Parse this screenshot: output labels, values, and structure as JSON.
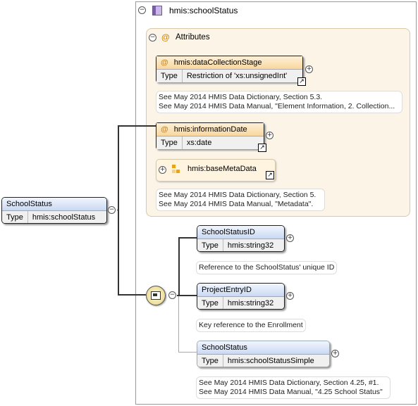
{
  "root": {
    "name": "SchoolStatus",
    "type_key": "Type",
    "type_value": "hmis:schoolStatus"
  },
  "complex_type": {
    "name": "hmis:schoolStatus"
  },
  "attributes_group": {
    "label": "Attributes"
  },
  "attributes": [
    {
      "name": "hmis:dataCollectionStage",
      "type_key": "Type",
      "type_value": "Restriction of 'xs:unsignedInt'",
      "doc": [
        "See May 2014 HMIS Data Dictionary, Section 5.3.",
        "See May 2014 HMIS Data Manual, \"Element Information, 2. Collection..."
      ]
    },
    {
      "name": "hmis:informationDate",
      "type_key": "Type",
      "type_value": "xs:date"
    }
  ],
  "attribute_group_ref": {
    "name": "hmis:baseMetaData",
    "doc": [
      "See May 2014 HMIS Data Dictionary, Section 5.",
      "See May 2014 HMIS Data Manual, \"Metadata\"."
    ]
  },
  "elements": [
    {
      "name": "SchoolStatusID",
      "type_key": "Type",
      "type_value": "hmis:string32",
      "doc": [
        "Reference to the SchoolStatus' unique ID"
      ]
    },
    {
      "name": "ProjectEntryID",
      "type_key": "Type",
      "type_value": "hmis:string32",
      "doc": [
        "Key reference to the Enrollment"
      ]
    },
    {
      "name": "SchoolStatus",
      "type_key": "Type",
      "type_value": "hmis:schoolStatusSimple",
      "doc": [
        "See May 2014 HMIS Data Dictionary, Section 4.25, #1.",
        "See May 2014 HMIS Data Manual, \"4.25 School Status\""
      ]
    }
  ],
  "icons": {
    "collapse": "−",
    "expand": "+",
    "link": "↗",
    "at": "@"
  }
}
